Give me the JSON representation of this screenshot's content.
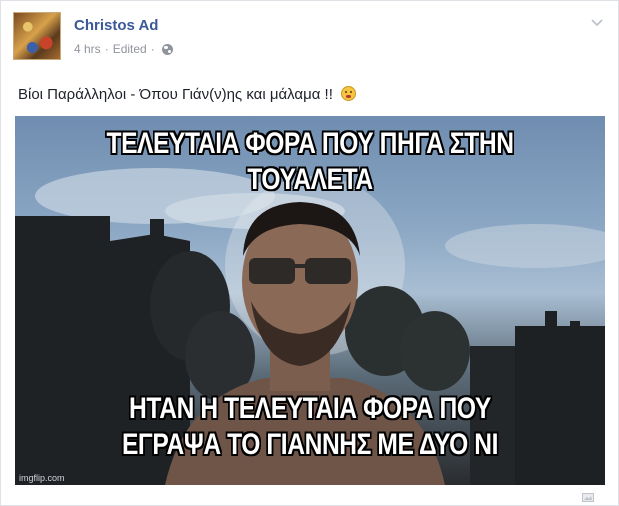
{
  "post": {
    "author": "Christos Ad",
    "time": "4 hrs",
    "separator": "·",
    "edited": "Edited",
    "privacy_icon": "globe-icon",
    "menu_icon": "chevron-down-icon",
    "caption": "Βίοι Παράλληλοι - Όπου Γιάν(ν)ης και μάλαμα !!",
    "caption_emoji": "embarrassed-face-emoji"
  },
  "meme": {
    "top_text": "ΤΕΛΕΥΤΑΙΑ ΦΟΡΑ ΠΟΥ ΠΗΓΑ ΣΤΗΝ ΤΟΥΑΛΕΤΑ",
    "bottom_line_1": "ΗΤΑΝ Η ΤΕΛΕΥΤΑΙΑ ΦΟΡΑ ΠΟΥ",
    "bottom_line_2": "ΕΓΡΑΨΑ ΤΟ ΓΙΑΝΝΗΣ ΜΕ ΔΥΟ ΝΙ",
    "watermark": "imgflip.com"
  },
  "colors": {
    "author_link": "#3b5998",
    "meta_text": "#90949c",
    "body_text": "#1d2129"
  }
}
